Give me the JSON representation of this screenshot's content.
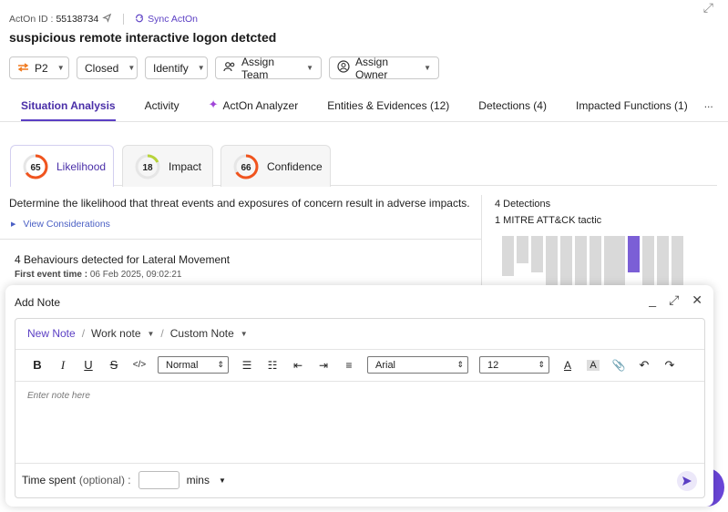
{
  "header": {
    "id_label": "ActOn ID :",
    "id_value": "55138734",
    "sync_label": "Sync ActOn",
    "title": "suspicious remote interactive logon detcted"
  },
  "toolbar": {
    "priority": "P2",
    "status": "Closed",
    "identify": "Identify",
    "assign_team": "Assign Team",
    "assign_owner": "Assign Owner"
  },
  "tabs": [
    {
      "label": "Situation Analysis"
    },
    {
      "label": "Activity"
    },
    {
      "label": "ActOn Analyzer"
    },
    {
      "label": "Entities & Evidences (12)"
    },
    {
      "label": "Detections (4)"
    },
    {
      "label": "Impacted Functions (1)"
    }
  ],
  "tabs_more": "...",
  "metrics": [
    {
      "score": "65",
      "label": "Likelihood",
      "color": "#f0541e"
    },
    {
      "score": "18",
      "label": "Impact",
      "color": "#b7d33a"
    },
    {
      "score": "66",
      "label": "Confidence",
      "color": "#f0541e"
    }
  ],
  "likelihood": {
    "description": "Determine the likelihood that threat events and exposures of concern result in adverse impacts.",
    "view_considerations": "View Considerations",
    "behaviours": "4 Behaviours detected for Lateral Movement",
    "first_event_label": "First event time :",
    "first_event_value": "06 Feb 2025, 09:02:21"
  },
  "detections": {
    "count": "4 Detections",
    "mitre": "1 MITRE ATT&CK tactic"
  },
  "note": {
    "title": "Add Note",
    "crumb_new": "New Note",
    "crumb_work": "Work note",
    "crumb_custom": "Custom Note",
    "style": "Normal",
    "font": "Arial",
    "size": "12",
    "placeholder": "Enter note here",
    "time_label": "Time spent",
    "time_optional": "(optional) :",
    "time_unit": "mins"
  },
  "colors": {
    "accent": "#5b3fc4",
    "heat_highlight": "#7b5fd6",
    "heat_default": "#d9d9d9"
  }
}
